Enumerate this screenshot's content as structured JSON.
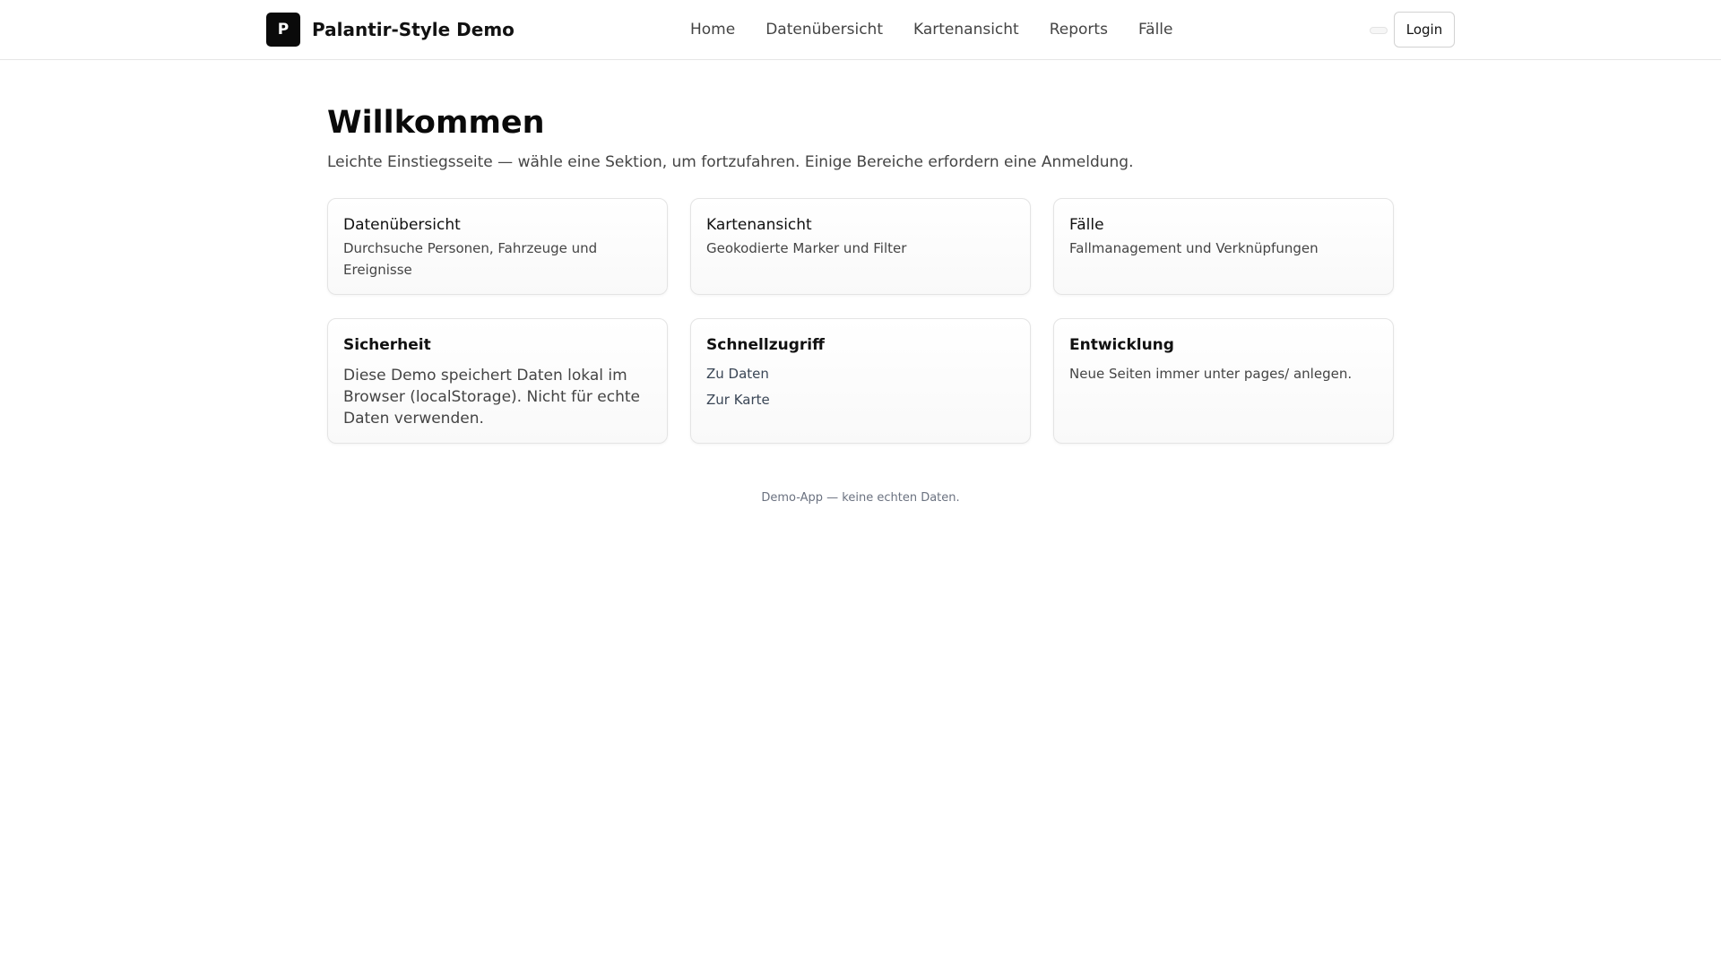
{
  "header": {
    "logo_letter": "P",
    "app_name": "Palantir-Style Demo",
    "nav": [
      "Home",
      "Datenübersicht",
      "Kartenansicht",
      "Reports",
      "Fälle"
    ],
    "login_label": "Login"
  },
  "main": {
    "title": "Willkommen",
    "subtitle": "Leichte Einstiegsseite — wähle eine Sektion, um fortzufahren. Einige Bereiche erfordern eine Anmeldung.",
    "section_cards": [
      {
        "title": "Datenübersicht",
        "description": "Durchsuche Personen, Fahrzeuge und Ereignisse"
      },
      {
        "title": "Kartenansicht",
        "description": "Geokodierte Marker und Filter"
      },
      {
        "title": "Fälle",
        "description": "Fallmanagement und Verknüpfungen"
      }
    ],
    "security": {
      "title": "Sicherheit",
      "text": "Diese Demo speichert Daten lokal im Browser (localStorage). Nicht für echte Daten verwenden."
    },
    "quick_access": {
      "title": "Schnellzugriff",
      "links": [
        "Zu Daten",
        "Zur Karte"
      ]
    },
    "development": {
      "title": "Entwicklung",
      "text": "Neue Seiten immer unter pages/ anlegen."
    }
  },
  "footer": {
    "text": "Demo-App — keine echten Daten."
  }
}
